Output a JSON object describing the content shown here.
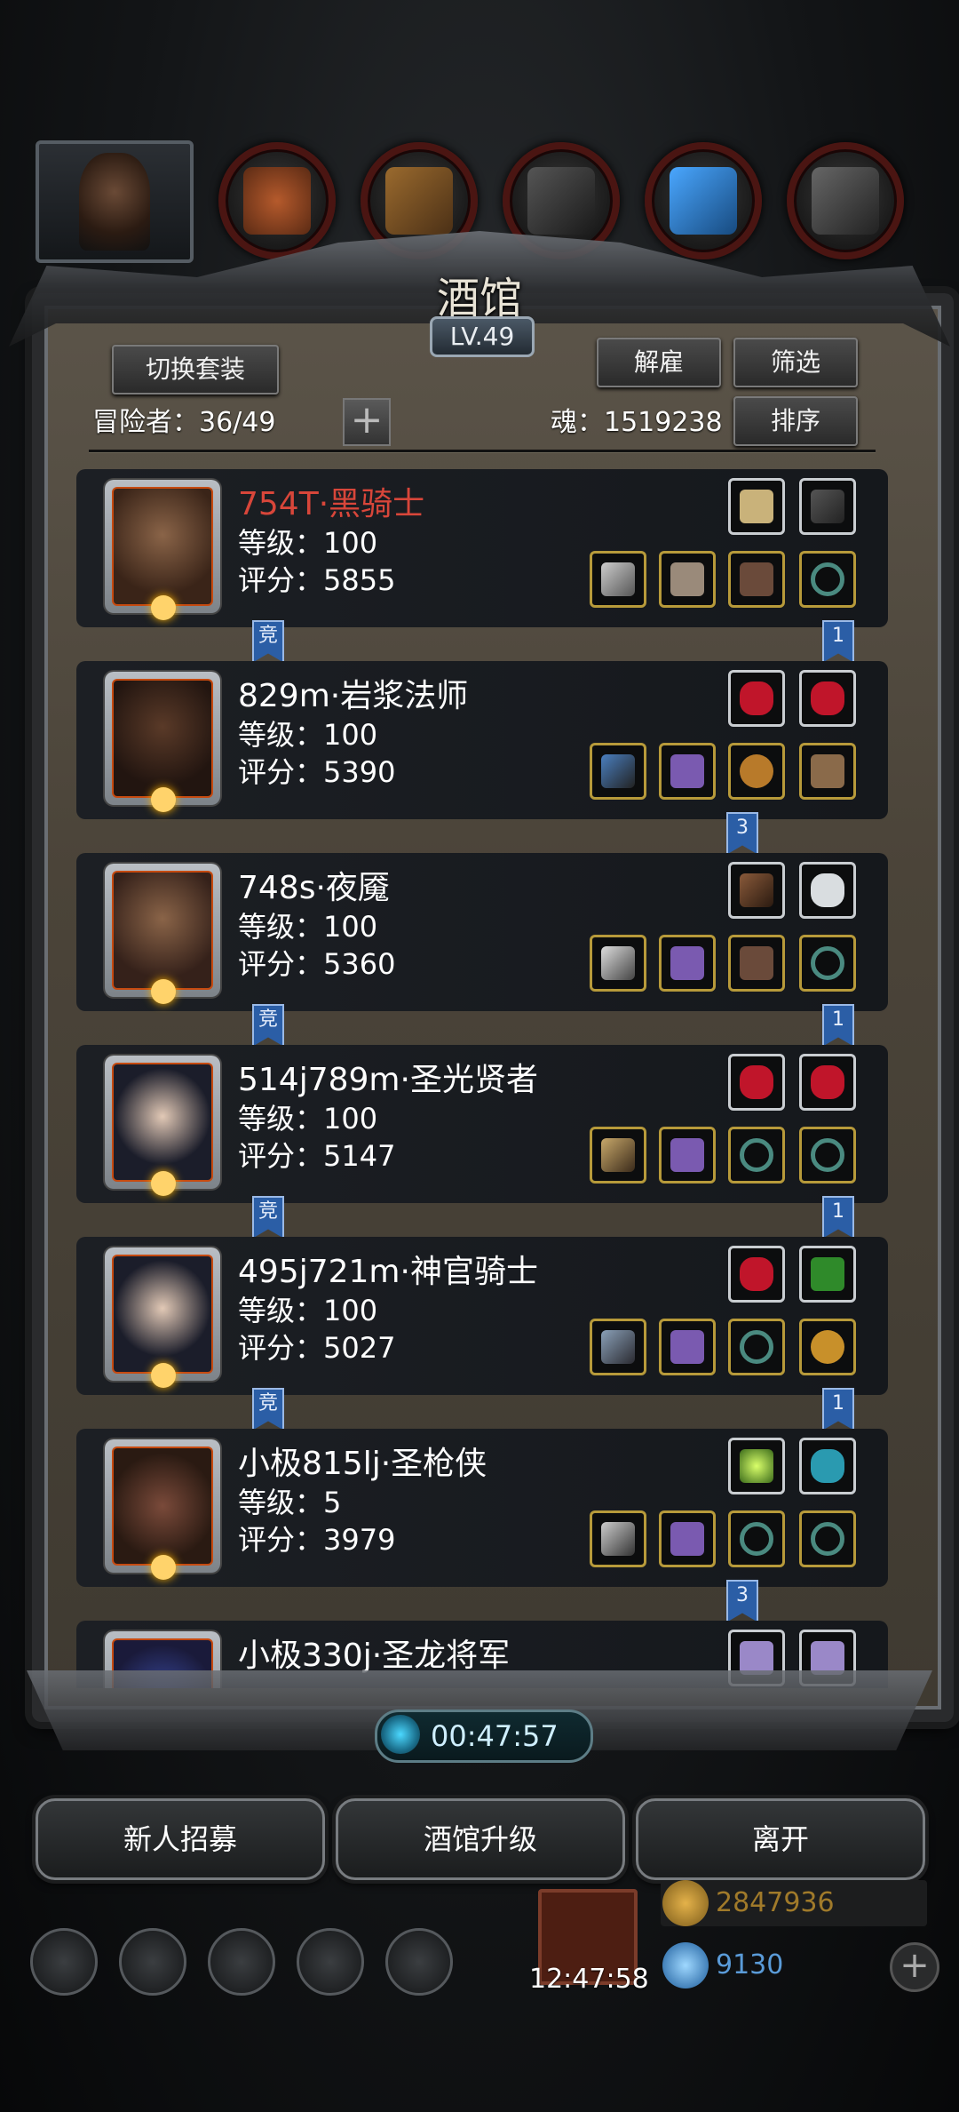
{
  "header": {
    "title": "酒馆",
    "level": "LV.49",
    "switch_outfit": "切换套装",
    "dismiss": "解雇",
    "filter": "筛选",
    "sort": "排序",
    "adventurers_label": "冒险者：36/49",
    "soul_label": "魂：1519238"
  },
  "tabs": [
    "portrait",
    "gloves-icon",
    "boots-icon",
    "chest-icon",
    "crystal-icon",
    "helmet-icon"
  ],
  "cards": [
    {
      "name": "754T·黑骑士",
      "name_color": "#d8463a",
      "level": "等级：100",
      "score": "评分：5855",
      "flag_left": "竞",
      "flag_right": "1"
    },
    {
      "name": "829m·岩浆法师",
      "level": "等级：100",
      "score": "评分：5390",
      "flag_mid": "3"
    },
    {
      "name": "748s·夜魇",
      "level": "等级：100",
      "score": "评分：5360",
      "flag_left": "竞",
      "flag_right": "1"
    },
    {
      "name": "514j789m·圣光贤者",
      "level": "等级：100",
      "score": "评分：5147",
      "flag_left": "竞",
      "flag_right": "1"
    },
    {
      "name": "495j721m·神官骑士",
      "level": "等级：100",
      "score": "评分：5027",
      "flag_left": "竞",
      "flag_right": "1"
    },
    {
      "name": "小极815lj·圣枪侠",
      "level": "等级：5",
      "score": "评分：3979",
      "flag_mid": "3"
    },
    {
      "name": "小极330j·圣龙将军"
    }
  ],
  "timer": "00:47:57",
  "buttons": {
    "recruit": "新人招募",
    "upgrade": "酒馆升级",
    "leave": "离开"
  },
  "footer": {
    "clock": "12:47:58",
    "gold": "2847936",
    "gems": "9130",
    "plus": "+",
    "gold_color": "#a07a2a",
    "gem_color": "#5a9bd8"
  }
}
